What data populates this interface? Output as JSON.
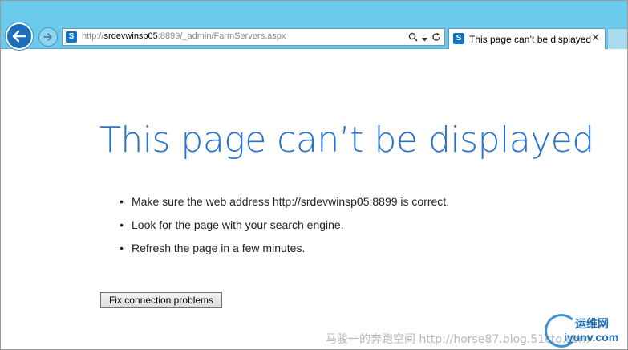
{
  "browser": {
    "back_label": "Back",
    "forward_label": "Forward",
    "address": {
      "protocol": "http://",
      "host": "srdevwinsp05",
      "rest": ":8899/_admin/FarmServers.aspx",
      "site_icon": "sharepoint-icon"
    },
    "address_tools": [
      "search-icon",
      "dropdown-icon",
      "refresh-icon"
    ],
    "tab": {
      "title": "This page can’t be displayed",
      "close_glyph": "✕"
    }
  },
  "page": {
    "heading": "This page can’t be displayed",
    "tips": [
      "Make sure the web address http://srdevwinsp05:8899 is correct.",
      "Look for the page with your search engine.",
      "Refresh the page in a few minutes."
    ],
    "fix_button": "Fix connection problems"
  },
  "watermark": {
    "text": "马骏一的奔跑空间 http://horse87.blog.51cto.com",
    "logo_cn": "运维网",
    "logo_en": "iyunv.com"
  },
  "colors": {
    "toolbar_bg": "#6ccbec",
    "heading": "#2672d4",
    "back_button": "#1a6fb8"
  }
}
